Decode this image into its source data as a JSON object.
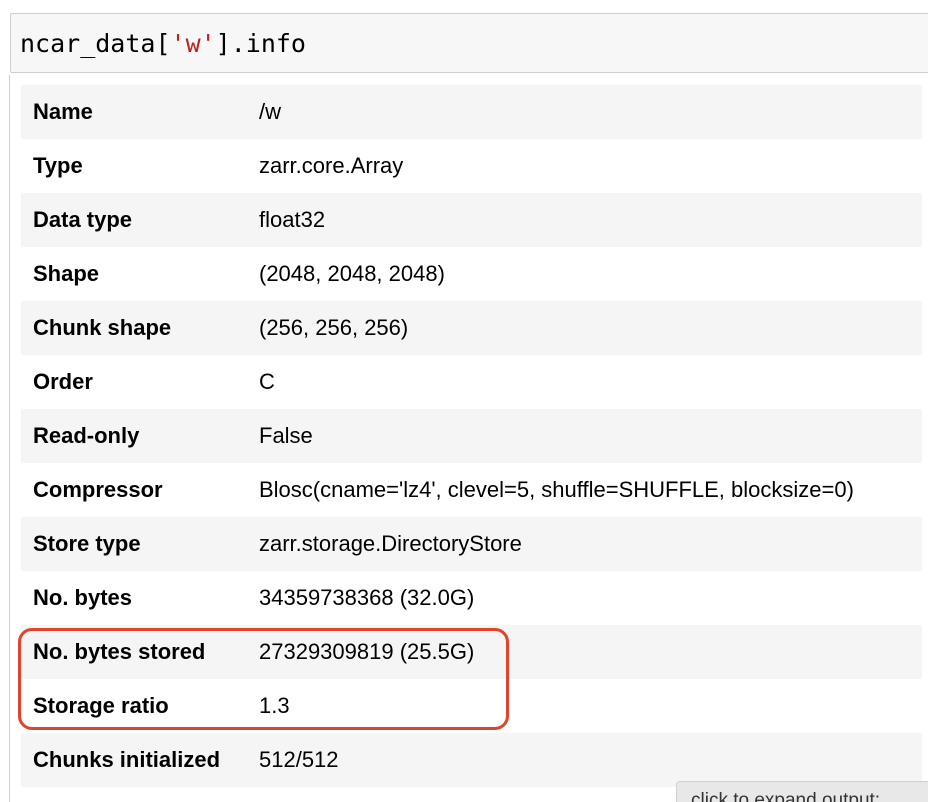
{
  "input_cell": {
    "code_prefix": "ncar_data[",
    "code_string": "'w'",
    "code_suffix": "].info"
  },
  "info_rows": [
    {
      "label": "Name",
      "value": "/w"
    },
    {
      "label": "Type",
      "value": "zarr.core.Array"
    },
    {
      "label": "Data type",
      "value": "float32"
    },
    {
      "label": "Shape",
      "value": "(2048, 2048, 2048)"
    },
    {
      "label": "Chunk shape",
      "value": "(256, 256, 256)"
    },
    {
      "label": "Order",
      "value": "C"
    },
    {
      "label": "Read-only",
      "value": "False"
    },
    {
      "label": "Compressor",
      "value": "Blosc(cname='lz4', clevel=5, shuffle=SHUFFLE, blocksize=0)"
    },
    {
      "label": "Store type",
      "value": "zarr.storage.DirectoryStore"
    },
    {
      "label": "No. bytes",
      "value": "34359738368 (32.0G)"
    },
    {
      "label": "No. bytes stored",
      "value": "27329309819 (25.5G)"
    },
    {
      "label": "Storage ratio",
      "value": "1.3"
    },
    {
      "label": "Chunks initialized",
      "value": "512/512"
    }
  ],
  "expand_output": {
    "label": "click to expand output;"
  },
  "colors": {
    "highlight_border": "#e0452c",
    "string_literal": "#ba2121",
    "row_stripe": "#f5f5f5"
  }
}
